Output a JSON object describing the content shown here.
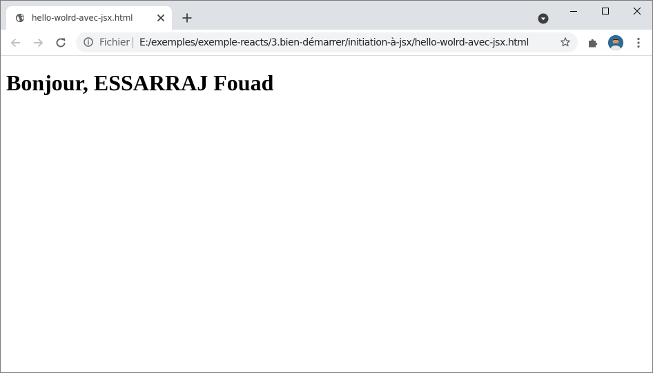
{
  "browser": {
    "tab": {
      "title": "hello-wolrd-avec-jsx.html",
      "favicon": "globe-icon",
      "close_icon": "close-icon"
    },
    "new_tab_icon": "plus-icon",
    "tab_search_icon": "chevron-down-circle-icon",
    "window_controls": [
      "minimize-icon",
      "maximize-icon",
      "close-icon"
    ]
  },
  "toolbar": {
    "back_icon": "arrow-left-icon",
    "forward_icon": "arrow-right-icon",
    "reload_icon": "reload-icon",
    "omnibox": {
      "security_icon": "info-icon",
      "chip_label": "Fichier",
      "url": "E:/exemples/exemple-reacts/3.bien-démarrer/initiation-à-jsx/hello-wolrd-avec-jsx.html",
      "bookmark_icon": "star-icon"
    },
    "extensions_icon": "puzzle-icon",
    "profile_icon": "avatar",
    "menu_icon": "kebab-menu-icon"
  },
  "page": {
    "heading": "Bonjour, ESSARRAJ Fouad"
  },
  "colors": {
    "tabstrip_bg": "#dee1e6",
    "omnibox_bg": "#f1f3f4",
    "icon_gray": "#5f6368",
    "icon_disabled": "#bdc1c6"
  }
}
